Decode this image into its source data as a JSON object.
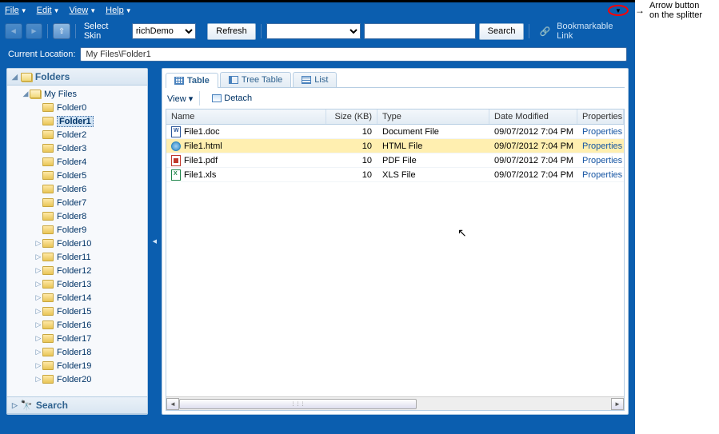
{
  "menubar": {
    "file": "File",
    "edit": "Edit",
    "view": "View",
    "help": "Help"
  },
  "toolbar": {
    "select_skin": "Select Skin",
    "skin_value": "richDemo",
    "refresh": "Refresh",
    "search_btn": "Search",
    "bookmark_link": "Bookmarkable Link"
  },
  "location": {
    "label": "Current Location:",
    "value": "My Files\\Folder1"
  },
  "sidebar": {
    "folders_title": "Folders",
    "root": "My Files",
    "items": [
      "Folder0",
      "Folder1",
      "Folder2",
      "Folder3",
      "Folder4",
      "Folder5",
      "Folder6",
      "Folder7",
      "Folder8",
      "Folder9",
      "Folder10",
      "Folder11",
      "Folder12",
      "Folder13",
      "Folder14",
      "Folder15",
      "Folder16",
      "Folder17",
      "Folder18",
      "Folder19",
      "Folder20"
    ],
    "selected_index": 1,
    "search_title": "Search"
  },
  "tabs": {
    "table": "Table",
    "tree_table": "Tree Table",
    "list": "List"
  },
  "content_toolbar": {
    "view": "View",
    "detach": "Detach"
  },
  "grid": {
    "headers": {
      "name": "Name",
      "size": "Size (KB)",
      "type": "Type",
      "date": "Date Modified",
      "props": "Properties"
    },
    "rows": [
      {
        "name": "File1.doc",
        "icon": "doc",
        "size": "10",
        "type": "Document File",
        "date": "09/07/2012 7:04 PM",
        "props": "Properties"
      },
      {
        "name": "File1.html",
        "icon": "html",
        "size": "10",
        "type": "HTML File",
        "date": "09/07/2012 7:04 PM",
        "props": "Properties"
      },
      {
        "name": "File1.pdf",
        "icon": "pdf",
        "size": "10",
        "type": "PDF File",
        "date": "09/07/2012 7:04 PM",
        "props": "Properties"
      },
      {
        "name": "File1.xls",
        "icon": "xls",
        "size": "10",
        "type": "XLS File",
        "date": "09/07/2012 7:04 PM",
        "props": "Properties"
      }
    ],
    "selected_row": 1
  },
  "annotation": {
    "line1": "Arrow button",
    "line2": "on the splitter"
  }
}
